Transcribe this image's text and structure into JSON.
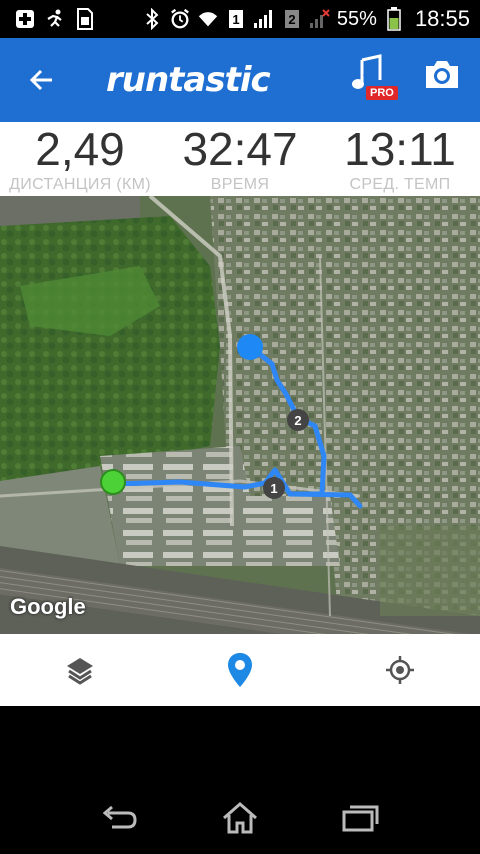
{
  "status_bar": {
    "battery_percent": "55%",
    "time": "18:55",
    "sim1": "1",
    "sim2": "2",
    "icons": [
      "add-icon",
      "runner-icon",
      "sim-card-icon",
      "bluetooth-icon",
      "alarm-icon",
      "wifi-icon",
      "signal-icon",
      "battery-icon"
    ]
  },
  "app_bar": {
    "logo_text": "runtastic",
    "pro_badge": "PRO",
    "icons": [
      "back-arrow-icon",
      "music-pro-icon",
      "camera-icon"
    ]
  },
  "stats": [
    {
      "value": "2,49",
      "label": "ДИСТАНЦИЯ (КМ)"
    },
    {
      "value": "32:47",
      "label": "ВРЕМЯ"
    },
    {
      "value": "13:11",
      "label": "СРЕД. ТЕМП"
    }
  ],
  "map": {
    "attribution": "Google",
    "route_color": "#2f86f5",
    "start_color": "#4cd137",
    "end_color": "#1e88f5",
    "km_markers": [
      "1",
      "2"
    ]
  },
  "toolbar": {
    "icons": [
      "layers-icon",
      "location-pin-icon",
      "my-location-icon"
    ],
    "accent": "#1e88e5"
  },
  "nav_bar": {
    "icons": [
      "back-nav-icon",
      "home-nav-icon",
      "recent-apps-icon"
    ]
  }
}
